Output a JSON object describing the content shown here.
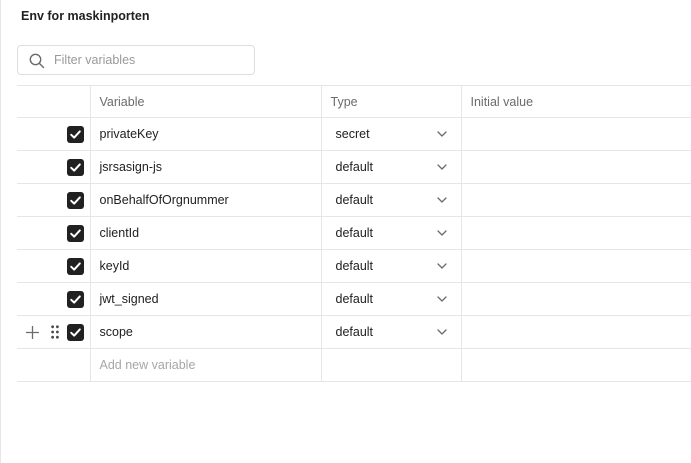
{
  "env": {
    "title": "Env for maskinporten"
  },
  "filter": {
    "placeholder": "Filter variables",
    "value": ""
  },
  "table": {
    "headers": {
      "variable": "Variable",
      "type": "Type",
      "initial_value": "Initial value"
    },
    "rows": [
      {
        "name": "privateKey",
        "type": "secret",
        "initial_value": "",
        "checked": true
      },
      {
        "name": "jsrsasign-js",
        "type": "default",
        "initial_value": "",
        "checked": true
      },
      {
        "name": "onBehalfOfOrgnummer",
        "type": "default",
        "initial_value": "",
        "checked": true
      },
      {
        "name": "clientId",
        "type": "default",
        "initial_value": "",
        "checked": true
      },
      {
        "name": "keyId",
        "type": "default",
        "initial_value": "",
        "checked": true
      },
      {
        "name": "jwt_signed",
        "type": "default",
        "initial_value": "",
        "checked": true
      },
      {
        "name": "scope",
        "type": "default",
        "initial_value": "",
        "checked": true
      }
    ],
    "add_placeholder": "Add new variable"
  },
  "icons": {
    "search": "search-icon",
    "checkbox": "checkmark-icon",
    "dropdown": "chevron-down-icon",
    "add_row": "plus-icon",
    "drag": "drag-handle-icon"
  },
  "colors": {
    "checkbox_fill": "#212121",
    "border": "#e6e6e6",
    "muted_text": "#6b6b6b"
  }
}
